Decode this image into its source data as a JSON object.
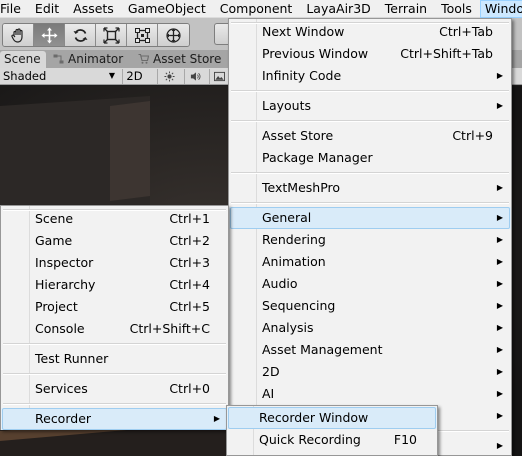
{
  "menubar": {
    "items": [
      "File",
      "Edit",
      "Assets",
      "GameObject",
      "Component",
      "LayaAir3D",
      "Terrain",
      "Tools",
      "Window"
    ]
  },
  "toolbar": {
    "tools": [
      "hand-tool",
      "move-tool",
      "rotate-tool",
      "scale-tool",
      "rect-tool",
      "transform-tool"
    ]
  },
  "tabs": {
    "scene": "Scene",
    "animator": "Animator",
    "asset_store": "Asset Store"
  },
  "scene_toolbar": {
    "shading": "Shaded",
    "mode_2d": "2D"
  },
  "window_menu": {
    "items": [
      {
        "label": "Next Window",
        "shortcut": "Ctrl+Tab"
      },
      {
        "label": "Previous Window",
        "shortcut": "Ctrl+Shift+Tab"
      },
      {
        "label": "Infinity Code",
        "shortcut": ""
      },
      {
        "label": "Layouts",
        "shortcut": ""
      },
      {
        "label": "Asset Store",
        "shortcut": "Ctrl+9"
      },
      {
        "label": "Package Manager",
        "shortcut": ""
      },
      {
        "label": "TextMeshPro",
        "shortcut": ""
      },
      {
        "label": "General",
        "shortcut": ""
      },
      {
        "label": "Rendering",
        "shortcut": ""
      },
      {
        "label": "Animation",
        "shortcut": ""
      },
      {
        "label": "Audio",
        "shortcut": ""
      },
      {
        "label": "Sequencing",
        "shortcut": ""
      },
      {
        "label": "Analysis",
        "shortcut": ""
      },
      {
        "label": "Asset Management",
        "shortcut": ""
      },
      {
        "label": "2D",
        "shortcut": ""
      },
      {
        "label": "AI",
        "shortcut": ""
      }
    ]
  },
  "general_menu": {
    "items": [
      {
        "label": "Scene",
        "shortcut": "Ctrl+1"
      },
      {
        "label": "Game",
        "shortcut": "Ctrl+2"
      },
      {
        "label": "Inspector",
        "shortcut": "Ctrl+3"
      },
      {
        "label": "Hierarchy",
        "shortcut": "Ctrl+4"
      },
      {
        "label": "Project",
        "shortcut": "Ctrl+5"
      },
      {
        "label": "Console",
        "shortcut": "Ctrl+Shift+C"
      },
      {
        "label": "Test Runner",
        "shortcut": ""
      },
      {
        "label": "Services",
        "shortcut": "Ctrl+0"
      },
      {
        "label": "Recorder",
        "shortcut": ""
      }
    ]
  },
  "recorder_menu": {
    "items": [
      {
        "label": "Recorder Window",
        "shortcut": ""
      },
      {
        "label": "Quick Recording",
        "shortcut": "F10"
      }
    ]
  },
  "colors": {
    "menu_bg": "#f2f2f2",
    "highlight": "#d9ebf9",
    "highlight_border": "#9fcdf0",
    "menubar_active": "#cce8ff",
    "toolbar": "#c2c2c2",
    "viewport": "#222222"
  }
}
